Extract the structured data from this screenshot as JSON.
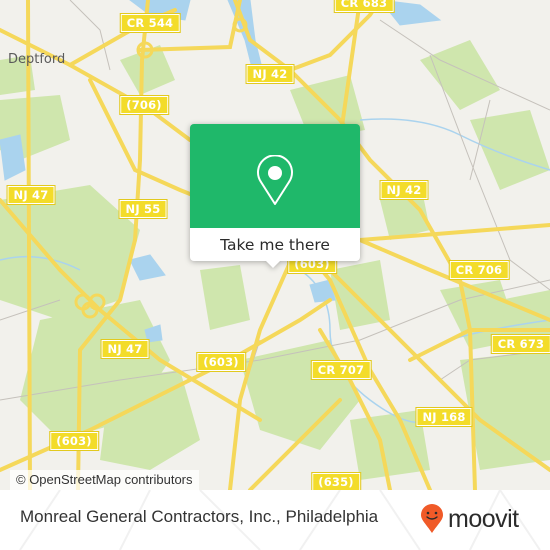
{
  "map": {
    "town_labels": [
      {
        "text": "Deptford",
        "name": "town-deptford"
      }
    ],
    "road_labels": [
      {
        "text": "CR 544",
        "name": "road-label-cr-544"
      },
      {
        "text": "CR 683",
        "name": "road-label-cr-683"
      },
      {
        "text": "NJ 42",
        "name": "road-label-nj-42-north"
      },
      {
        "text": "(706)",
        "name": "road-label-706"
      },
      {
        "text": "NJ 47",
        "name": "road-label-nj-47-north"
      },
      {
        "text": "NJ 55",
        "name": "road-label-nj-55"
      },
      {
        "text": "NJ 42",
        "name": "road-label-nj-42-south"
      },
      {
        "text": "(603)",
        "name": "road-label-603-center"
      },
      {
        "text": "CR 706",
        "name": "road-label-cr-706"
      },
      {
        "text": "CR 673",
        "name": "road-label-cr-673"
      },
      {
        "text": "NJ 47",
        "name": "road-label-nj-47-south"
      },
      {
        "text": "(603)",
        "name": "road-label-603-mid"
      },
      {
        "text": "CR 707",
        "name": "road-label-cr-707"
      },
      {
        "text": "NJ 168",
        "name": "road-label-nj-168"
      },
      {
        "text": "(603)",
        "name": "road-label-603-west"
      },
      {
        "text": "(635)",
        "name": "road-label-635"
      }
    ],
    "attribution": "© OpenStreetMap contributors"
  },
  "popup": {
    "button_label": "Take me there",
    "icon": "map-pin-icon",
    "accent_color": "#1fb86a"
  },
  "footer": {
    "title": "Monreal General Contractors, Inc., Philadelphia",
    "brand": "moovit",
    "brand_color": "#f05a28"
  }
}
